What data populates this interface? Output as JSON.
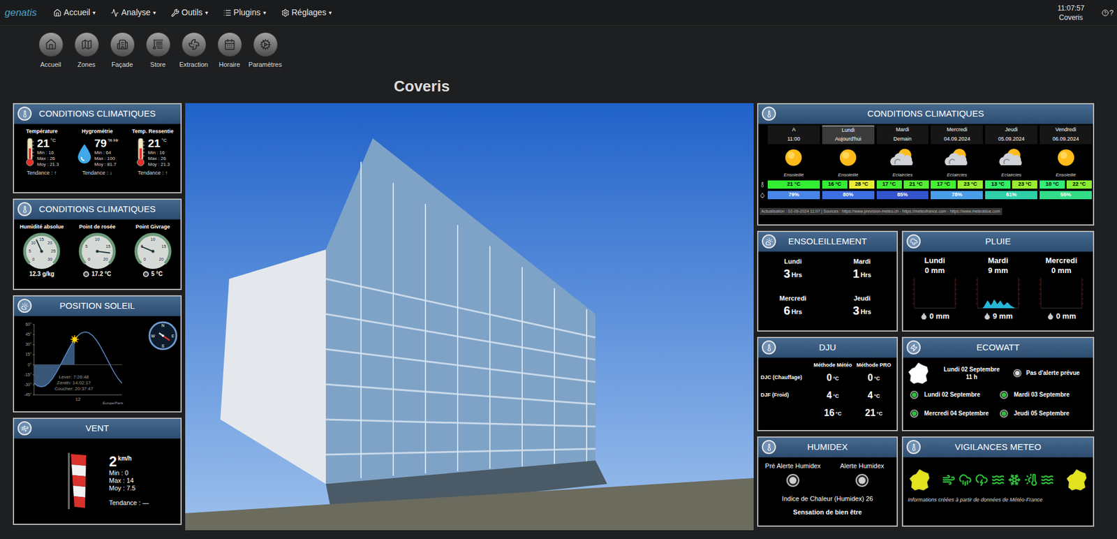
{
  "navbar": {
    "logo": "genatis",
    "caret": "▾",
    "menus": [
      {
        "label": "Accueil"
      },
      {
        "label": "Analyse"
      },
      {
        "label": "Outils"
      },
      {
        "label": "Plugins"
      },
      {
        "label": "Réglages"
      }
    ],
    "clock": "11:07:57",
    "site": "Coveris",
    "help": "?"
  },
  "toolbar": [
    {
      "label": "Accueil"
    },
    {
      "label": "Zones"
    },
    {
      "label": "Façade"
    },
    {
      "label": "Store"
    },
    {
      "label": "Extraction"
    },
    {
      "label": "Horaire"
    },
    {
      "label": "Paramètres"
    }
  ],
  "page_title": "Coveris",
  "climate": {
    "title": "CONDITIONS CLIMATIQUES",
    "trend_label": "Tendance :",
    "items": [
      {
        "kind": "thermometer",
        "label": "Température",
        "value": "21",
        "unit": "°C",
        "min": "Min : 16",
        "max": "Max : 26",
        "avg": "Moy : 21.3",
        "trend": "↑",
        "level": 0.55
      },
      {
        "kind": "drop",
        "label": "Hygrométrie",
        "value": "79",
        "unit": "% Hr",
        "min": "Min : 64",
        "max": "Max : 100",
        "avg": "Moy : 81.7",
        "trend": "↓",
        "level": 0.79
      },
      {
        "kind": "thermometer",
        "label": "Temp. Ressentie",
        "value": "21",
        "unit": "°C",
        "min": "Min : 16",
        "max": "Max : 26",
        "avg": "Moy : 21.3",
        "trend": "↑",
        "level": 0.55
      }
    ]
  },
  "gauges": {
    "title": "CONDITIONS CLIMATIQUES",
    "items": [
      {
        "label": "Humidité absolue",
        "reading": "12.3 g/kg",
        "ticks": [
          "0",
          "5",
          "10",
          "15",
          "20",
          "25",
          "30"
        ],
        "level": 0.41,
        "indicator": false
      },
      {
        "label": "Point de rosée",
        "reading": "17.2 °C",
        "ticks": [
          "0",
          "5",
          "10",
          "15",
          "20"
        ],
        "level": 0.86,
        "indicator": true
      },
      {
        "label": "Point Givrage",
        "reading": "5 °C",
        "ticks": [
          "0",
          "5",
          "10",
          "15",
          "20"
        ],
        "level": 0.25,
        "indicator": true
      }
    ]
  },
  "sun": {
    "title": "POSITION SOLEIL",
    "y_ticks": [
      "60°",
      "45°",
      "30°",
      "15°",
      "0°",
      "-15°",
      "-30°",
      "-45°"
    ],
    "x_tick": "12",
    "timezone": "Europe/Paris",
    "sunrise": "Lever: 7:26:48",
    "zenith": "Zénith: 14:02:17",
    "sunset": "Coucher: 20:37:47",
    "elevation": [
      -27.5,
      -31.6,
      -33,
      -31.6,
      -27.5,
      -21,
      -12.5,
      -2.6,
      8,
      18.6,
      28.5,
      37,
      43.5,
      47.6,
      49,
      47.6,
      43.5,
      37,
      28.5,
      18.6,
      8,
      -2.6,
      -12.5,
      -21,
      -27.5
    ],
    "current": {
      "hour": 11.1,
      "elevation": 38
    },
    "compass": {
      "north": "N",
      "east": "E",
      "south": "S",
      "west": "W",
      "azimuth": 125
    }
  },
  "wind": {
    "title": "VENT",
    "value": "2",
    "unit": "km/h",
    "min": "Min : 0",
    "max": "Max : 14",
    "avg": "Moy : 7.5",
    "trend_label": "Tendance :",
    "trend": "—"
  },
  "forecast": {
    "title": "CONDITIONS CLIMATIQUES",
    "days": [
      {
        "day": "A",
        "date": "11:00",
        "kind": "sun",
        "label": "Ensoleillé",
        "selected": false,
        "temps": [
          {
            "text": "21 °C",
            "color": "#33ee33"
          }
        ],
        "humidity": {
          "text": "79%",
          "color": "#4a86e8"
        }
      },
      {
        "day": "Lundi",
        "date": "Aujourd'hui",
        "kind": "sun",
        "label": "Ensoleillé",
        "selected": true,
        "temps": [
          {
            "text": "16 °C",
            "color": "#33ee33"
          },
          {
            "text": "28 °C",
            "color": "#e6ee33"
          }
        ],
        "humidity": {
          "text": "80%",
          "color": "#3d6fe0"
        }
      },
      {
        "day": "Mardi",
        "date": "Demain",
        "kind": "cloud-sun",
        "label": "Eclaircies",
        "selected": false,
        "temps": [
          {
            "text": "17 °C",
            "color": "#44ee33"
          },
          {
            "text": "21 °C",
            "color": "#55ee33"
          }
        ],
        "humidity": {
          "text": "85%",
          "color": "#3355cc"
        }
      },
      {
        "day": "Mercredi",
        "date": "04.09.2024",
        "kind": "cloud-sun",
        "label": "Eclaircies",
        "selected": false,
        "temps": [
          {
            "text": "17 °C",
            "color": "#44ee33"
          },
          {
            "text": "23 °C",
            "color": "#99ee33"
          }
        ],
        "humidity": {
          "text": "78%",
          "color": "#4a9ee8"
        }
      },
      {
        "day": "Jeudi",
        "date": "05.09.2024",
        "kind": "cloud-sun",
        "label": "Eclaircies",
        "selected": false,
        "temps": [
          {
            "text": "13 °C",
            "color": "#33ee66"
          },
          {
            "text": "23 °C",
            "color": "#99ee33"
          }
        ],
        "humidity": {
          "text": "61%",
          "color": "#2fcfaa"
        }
      },
      {
        "day": "Vendredi",
        "date": "06.09.2024",
        "kind": "sun",
        "label": "Ensoleillé",
        "selected": false,
        "temps": [
          {
            "text": "10 °C",
            "color": "#33ee77"
          },
          {
            "text": "22 °C",
            "color": "#88ee33"
          }
        ],
        "humidity": {
          "text": "55%",
          "color": "#33dd88"
        }
      }
    ],
    "footer": "Actualisation : 02-09-2024 11:07 | Sources : https://www.prevision-meteo.ch - https://meteofrance.com - https://www.meteoblue.com"
  },
  "sunshine": {
    "title": "ENSOLEILLEMENT",
    "unit": "Hrs",
    "days": [
      {
        "day": "Lundi",
        "hours": "3"
      },
      {
        "day": "Mardi",
        "hours": "1"
      },
      {
        "day": "Mercredi",
        "hours": "6"
      },
      {
        "day": "Jeudi",
        "hours": "3"
      }
    ]
  },
  "rain": {
    "title": "PLUIE",
    "days": [
      {
        "day": "Lundi",
        "total": "0 mm",
        "gauge": "0 mm",
        "hourly": [
          0,
          0,
          0,
          0,
          0,
          0,
          0,
          0,
          0,
          0,
          0,
          0,
          0,
          0,
          0,
          0,
          0,
          0,
          0,
          0,
          0,
          0,
          0,
          0
        ]
      },
      {
        "day": "Mardi",
        "total": "9 mm",
        "gauge": "9 mm",
        "hourly": [
          0,
          0,
          0,
          0.2,
          0.5,
          0.8,
          0.6,
          0.3,
          0.5,
          0.9,
          0.7,
          0.4,
          0.6,
          0.8,
          0.5,
          0.3,
          0.4,
          0.6,
          0.5,
          0.3,
          0.2,
          0.1,
          0,
          0
        ]
      },
      {
        "day": "Mercredi",
        "total": "0 mm",
        "gauge": "0 mm",
        "hourly": [
          0,
          0,
          0,
          0,
          0,
          0,
          0,
          0,
          0,
          0,
          0,
          0,
          0,
          0,
          0,
          0,
          0,
          0,
          0,
          0,
          0,
          0,
          0,
          0
        ]
      }
    ]
  },
  "dju": {
    "title": "DJU",
    "unit": "°C",
    "columns": [
      "Méthode Météo",
      "Méthode PRO"
    ],
    "rows": [
      {
        "label": "DJC (Chauffage)",
        "values": [
          "0",
          "0"
        ]
      },
      {
        "label": "DJF (Froid)",
        "values": [
          "4",
          "4"
        ]
      },
      {
        "label": "",
        "values": [
          "16",
          "21"
        ]
      }
    ]
  },
  "ecowatt": {
    "title": "ECOWATT",
    "now": {
      "date": "Lundi 02 Septembre",
      "hour": "11 h",
      "status": "Pas d'alerte prévue",
      "color": "#d9d9d9"
    },
    "days": [
      {
        "date": "Lundi 02 Septembre",
        "color": "#2fbf3a"
      },
      {
        "date": "Mardi 03 Septembre",
        "color": "#2fbf3a"
      },
      {
        "date": "Mercredi 04 Septembre",
        "color": "#2fbf3a"
      },
      {
        "date": "Jeudi 05 Septembre",
        "color": "#2fbf3a"
      }
    ]
  },
  "humidex": {
    "title": "HUMIDEX",
    "alerts": [
      {
        "label": "Pré Alerte Humidex",
        "on": false
      },
      {
        "label": "Alerte Humidex",
        "on": false
      }
    ],
    "index": "Indice de Chaleur (Humidex) 26",
    "feeling": "Sensation de bien être"
  },
  "vigilance": {
    "title": "VIGILANCES METEO",
    "maps": [
      {
        "color": "#e2e21e"
      },
      {
        "color": "#e2e21e"
      }
    ],
    "hazards": [
      {
        "kind": "wind",
        "color": "#2fbf3a"
      },
      {
        "kind": "rain",
        "color": "#2fbf3a"
      },
      {
        "kind": "storm",
        "color": "#2fbf3a"
      },
      {
        "kind": "flood",
        "color": "#2fbf3a"
      },
      {
        "kind": "snow",
        "color": "#2fbf3a"
      },
      {
        "kind": "heat",
        "color": "#2fbf3a"
      },
      {
        "kind": "waves",
        "color": "#2fbf3a"
      }
    ],
    "note": "Informations créées à partir de données de Météo-France"
  }
}
